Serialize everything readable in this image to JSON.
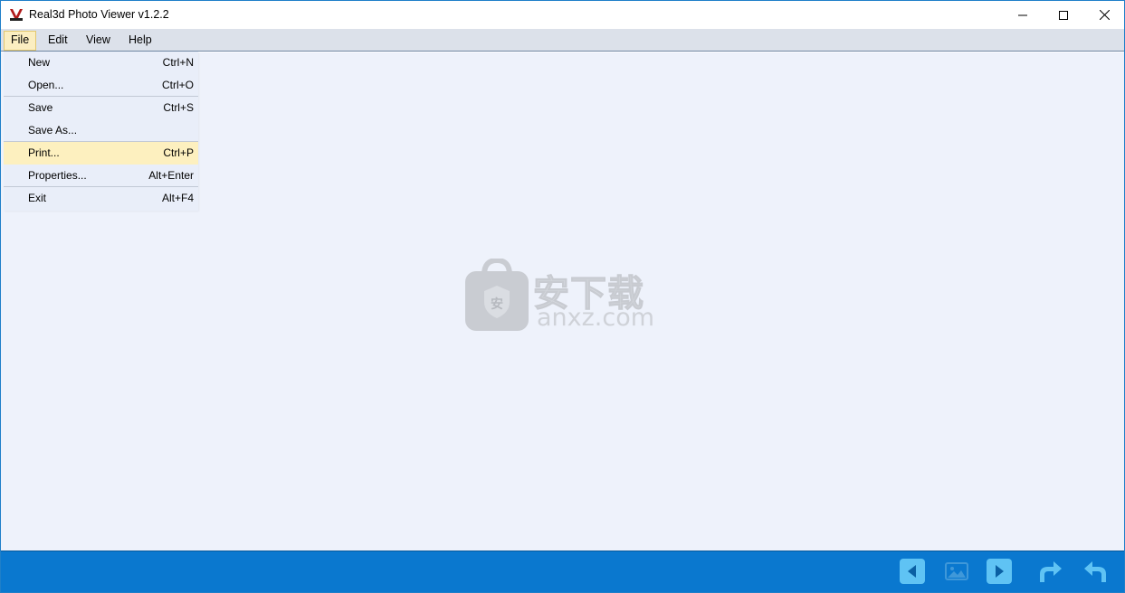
{
  "window": {
    "title": "Real3d Photo Viewer v1.2.2"
  },
  "titlebar_buttons": {
    "minimize_icon": "minimize-icon",
    "maximize_icon": "maximize-icon",
    "close_icon": "close-icon"
  },
  "menubar": {
    "items": [
      {
        "label": "File",
        "active": true
      },
      {
        "label": "Edit",
        "active": false
      },
      {
        "label": "View",
        "active": false
      },
      {
        "label": "Help",
        "active": false
      }
    ]
  },
  "file_menu": {
    "items": [
      {
        "label": "New",
        "shortcut": "Ctrl+N"
      },
      {
        "label": "Open...",
        "shortcut": "Ctrl+O"
      },
      {
        "label": "Save",
        "shortcut": "Ctrl+S"
      },
      {
        "label": "Save As...",
        "shortcut": ""
      },
      {
        "label": "Print...",
        "shortcut": "Ctrl+P"
      },
      {
        "label": "Properties...",
        "shortcut": "Alt+Enter"
      },
      {
        "label": "Exit",
        "shortcut": "Alt+F4"
      }
    ],
    "highlighted": "Print..."
  },
  "watermark": {
    "cn_text": "安下载",
    "en_text": "anxz.com",
    "badge_text": "安"
  },
  "toolbar": {
    "buttons": [
      {
        "icon": "previous-icon"
      },
      {
        "icon": "image-icon"
      },
      {
        "icon": "next-icon"
      },
      {
        "icon": "rotate-right-icon"
      },
      {
        "icon": "rotate-left-icon"
      }
    ]
  },
  "colors": {
    "menubar_bg": "#dce1ea",
    "content_bg": "#eef2fb",
    "menu_bg": "#e9eef9",
    "highlight": "#fdf0bf",
    "toolbar_bg": "#0a78cf",
    "toolbar_icon": "#5fc3f4"
  }
}
